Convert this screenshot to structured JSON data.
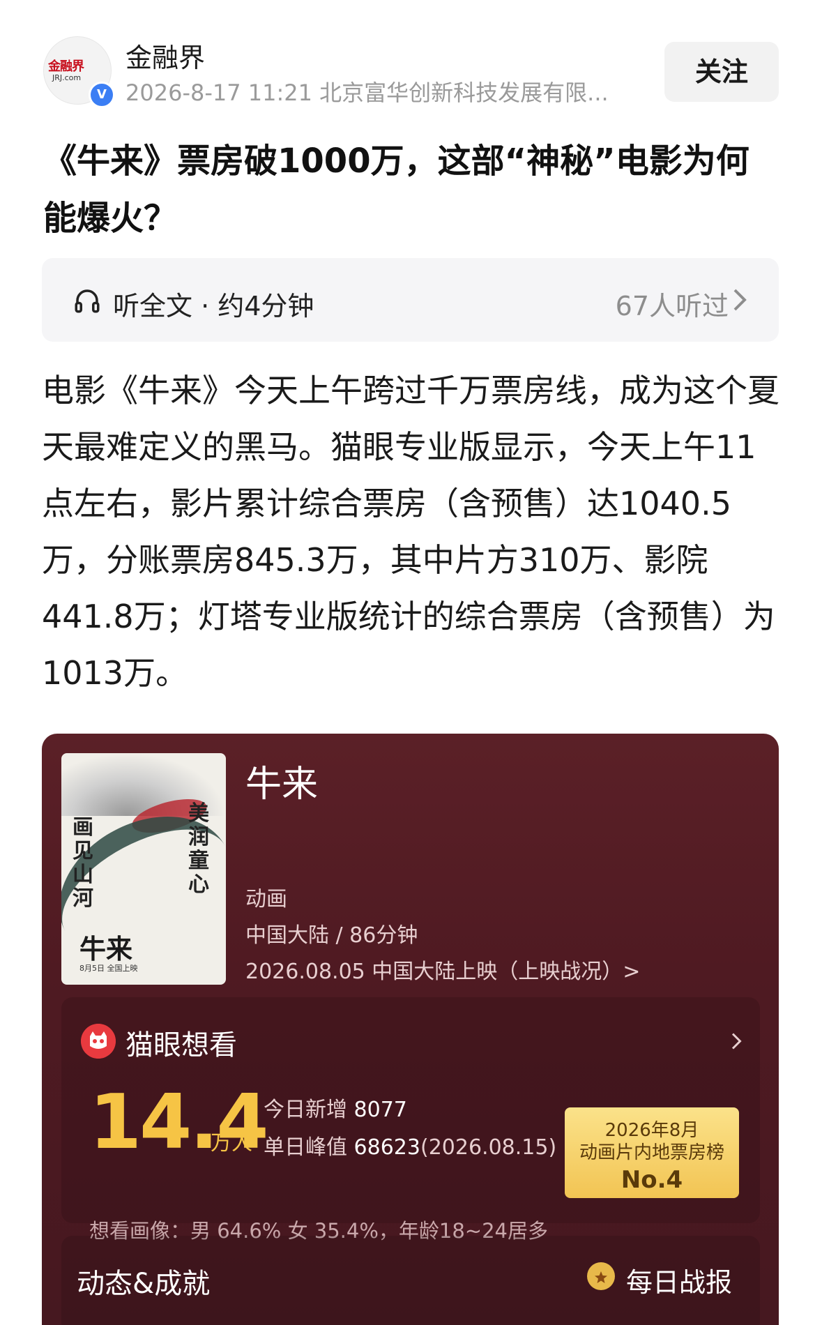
{
  "header": {
    "account_name": "金融界",
    "logo_text": "金融界",
    "logo_sub": "JRJ.com",
    "verified_mark": "V",
    "meta": "2026-8-17  11:21  北京富华创新科技发展有限...",
    "follow_label": "关注"
  },
  "article": {
    "title": "《牛来》票房破1000万，这部“神秘”电影为何能爆火？",
    "listen_label": "听全文 · 约4分钟",
    "listen_count": "67人听过",
    "body": "电影《牛来》今天上午跨过千万票房线，成为这个夏天最难定义的黑马。猫眼专业版显示，今天上午11点左右，影片累计综合票房（含预售）达1040.5万，分账票房845.3万，其中片方310万、影院441.8万；灯塔专业版统计的综合票房（含预售）为1013万。"
  },
  "movie_card": {
    "poster": {
      "calligraphy_left": "画见山河",
      "calligraphy_right": "美润童心",
      "title": "牛来",
      "date_line": "8月5日  全国上映"
    },
    "name": "牛来",
    "genre": "动画",
    "region_runtime": "中国大陆 / 86分钟",
    "release": "2026.08.05 中国大陆上映（上映战况）>",
    "want_to_see": {
      "title": "猫眼想看",
      "count": "14.4",
      "unit": "万人",
      "today_label": "今日新增",
      "today_value": "8077",
      "peak_label": "单日峰值",
      "peak_value": "68623",
      "peak_date": "(2026.08.15)",
      "rank_line1": "2026年8月",
      "rank_line2": "动画片内地票房榜",
      "rank_line3": "No.4",
      "profile": "想看画像：男 64.6%  女 35.4%，年龄18~24居多"
    },
    "dynamics": {
      "title": "动态&成就",
      "daily_report": "每日战报"
    }
  },
  "colors": {
    "card_bg": "#4f1a22",
    "accent_gold": "#f6c445",
    "verified_blue": "#3b7ef4",
    "maoyan_red": "#e83a3f"
  },
  "icons": [
    "verified-icon",
    "headphones-icon",
    "chevron-right-icon",
    "maoyan-cat-icon",
    "medal-icon"
  ]
}
